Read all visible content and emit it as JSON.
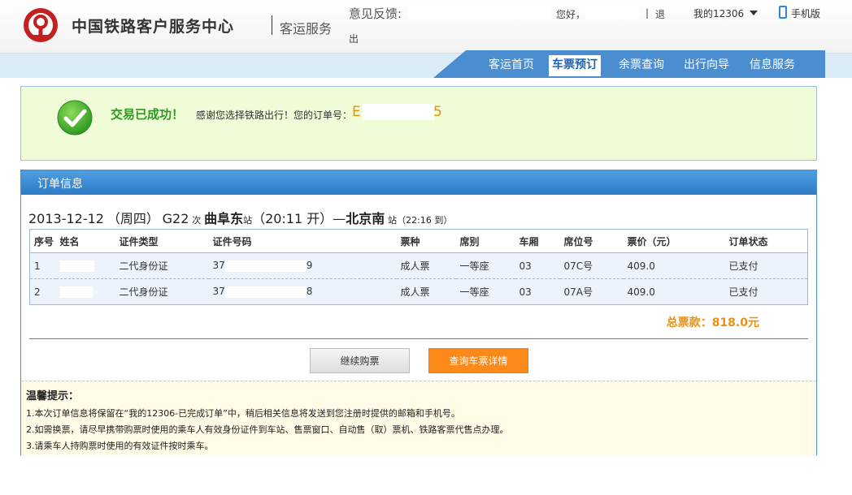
{
  "header": {
    "site_name": "中国铁路客户服务中心",
    "site_sub": "客运服务",
    "feedback_label": "意见反馈:",
    "greeting": "您好，",
    "logout_sep": "|",
    "logout_part1": "退",
    "logout_part2": "出",
    "my_account": "我的12306",
    "mobile": "手机版"
  },
  "nav": {
    "items": [
      "客运首页",
      "车票预订",
      "余票查询",
      "出行向导",
      "信息服务"
    ],
    "active": "车票预订"
  },
  "success": {
    "title": "交易已成功！",
    "thanks": "感谢您选择铁路出行！您的订单号：",
    "order_no_prefix": "E",
    "order_no_suffix": "5"
  },
  "order": {
    "panel_title": "订单信息",
    "trip": {
      "date": "2013-12-12",
      "weekday": "（周四）",
      "train": "G22",
      "train_suffix": "次",
      "from": "曲阜东",
      "from_suffix": "站",
      "depart": "（20:11 开）",
      "dash": "—",
      "to": "北京南",
      "to_suffix": "站",
      "arrive": "（22:16 到）"
    },
    "columns": [
      "序号",
      "姓名",
      "证件类型",
      "证件号码",
      "票种",
      "席别",
      "车厢",
      "席位号",
      "票价（元）",
      "订单状态"
    ],
    "rows": [
      {
        "no": "1",
        "id_type": "二代身份证",
        "id_prefix": "37",
        "id_suffix": "9",
        "ticket_type": "成人票",
        "seat_class": "一等座",
        "car": "03",
        "seat": "07C号",
        "price": "409.0",
        "status": "已支付"
      },
      {
        "no": "2",
        "id_type": "二代身份证",
        "id_prefix": "37",
        "id_suffix": "8",
        "ticket_type": "成人票",
        "seat_class": "一等座",
        "car": "03",
        "seat": "07A号",
        "price": "409.0",
        "status": "已支付"
      }
    ],
    "total": "总票款：818.0元",
    "btn_continue": "继续购票",
    "btn_detail": "查询车票详情"
  },
  "tips": {
    "title": "温馨提示：",
    "lines": [
      "1.本次订单信息将保留在“我的12306-已完成订单”中，稍后相关信息将发送到您注册时提供的邮箱和手机号。",
      "2.如需换票，请尽早携带购票时使用的乘车人有效身份证件到车站、售票窗口、自动售（取）票机、铁路客票代售点办理。",
      "3.请乘车人持购票时使用的有效证件按时乘车。"
    ]
  },
  "colors": {
    "brand_red": "#c4201f",
    "nav_blue": "#4a8ed0",
    "success_green": "#2e9a1f",
    "accent_orange": "#f18d00"
  }
}
